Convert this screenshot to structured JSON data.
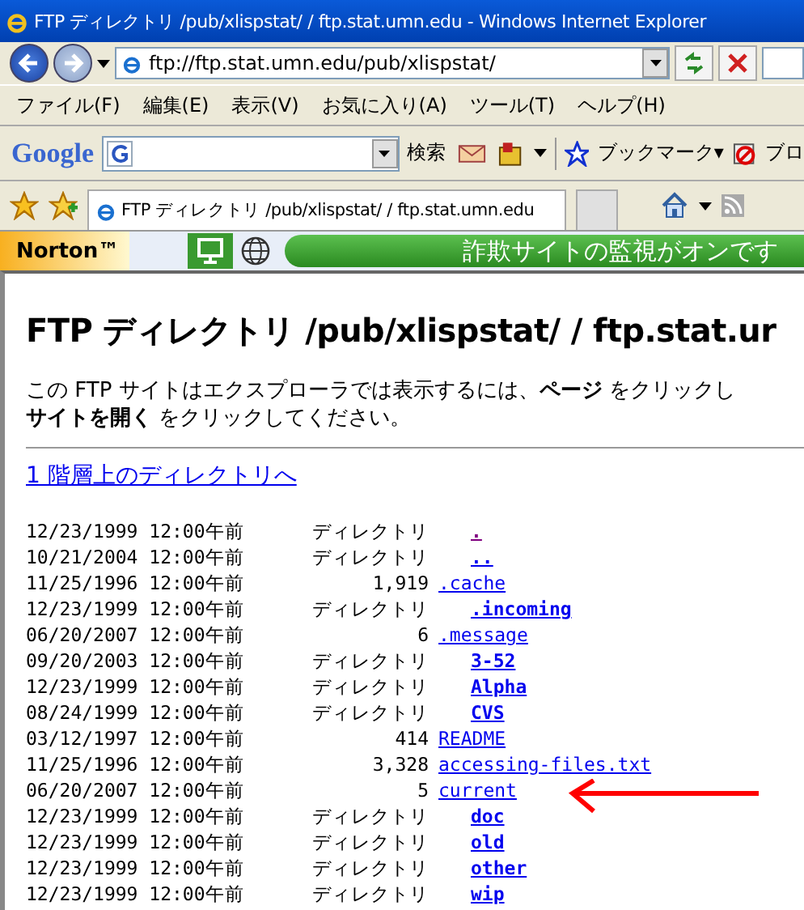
{
  "window": {
    "title": "FTP ディレクトリ /pub/xlispstat/ / ftp.stat.umn.edu - Windows Internet Explorer"
  },
  "address_bar": {
    "value": "ftp://ftp.stat.umn.edu/pub/xlispstat/"
  },
  "menu": [
    "ファイル(F)",
    "編集(E)",
    "表示(V)",
    "お気に入り(A)",
    "ツール(T)",
    "ヘルプ(H)"
  ],
  "google_toolbar": {
    "logo": "Google",
    "search_button": "検索",
    "bookmarks": "ブックマーク▾",
    "cut_item": "ブロ"
  },
  "tabs": [
    {
      "label": "FTP ディレクトリ /pub/xlispstat/ / ftp.stat.umn.edu",
      "selected": true
    }
  ],
  "norton": {
    "logo": "Norton™",
    "status": "詐欺サイトの監視がオンです"
  },
  "page": {
    "heading": "FTP ディレクトリ /pub/xlispstat/ / ftp.stat.ur",
    "notice": "この FTP サイトはエクスプローラでは表示するには、**ページ** をクリックし",
    "notice_2": "**サイトを開く** をクリックしてください。",
    "up_link": "1 階層上のディレクトリへ",
    "rows": [
      {
        "date": "12/23/1999 12:00午前",
        "size": "ディレクトリ",
        "name": ".",
        "kind": "dir",
        "visited": true
      },
      {
        "date": "10/21/2004 12:00午前",
        "size": "ディレクトリ",
        "name": "..",
        "kind": "dir",
        "visited": false
      },
      {
        "date": "11/25/1996 12:00午前",
        "size": "1,919",
        "name": ".cache",
        "kind": "file",
        "visited": false
      },
      {
        "date": "12/23/1999 12:00午前",
        "size": "ディレクトリ",
        "name": ".incoming",
        "kind": "dir",
        "visited": false
      },
      {
        "date": "06/20/2007 12:00午前",
        "size": "6",
        "name": ".message",
        "kind": "file",
        "visited": false
      },
      {
        "date": "09/20/2003 12:00午前",
        "size": "ディレクトリ",
        "name": "3-52",
        "kind": "dir",
        "visited": false
      },
      {
        "date": "12/23/1999 12:00午前",
        "size": "ディレクトリ",
        "name": "Alpha",
        "kind": "dir",
        "visited": false
      },
      {
        "date": "08/24/1999 12:00午前",
        "size": "ディレクトリ",
        "name": "CVS",
        "kind": "dir",
        "visited": false
      },
      {
        "date": "03/12/1997 12:00午前",
        "size": "414",
        "name": "README",
        "kind": "file",
        "visited": false
      },
      {
        "date": "11/25/1996 12:00午前",
        "size": "3,328",
        "name": "accessing-files.txt",
        "kind": "file",
        "visited": false
      },
      {
        "date": "06/20/2007 12:00午前",
        "size": "5",
        "name": "current",
        "kind": "file",
        "visited": false
      },
      {
        "date": "12/23/1999 12:00午前",
        "size": "ディレクトリ",
        "name": "doc",
        "kind": "dir",
        "visited": false
      },
      {
        "date": "12/23/1999 12:00午前",
        "size": "ディレクトリ",
        "name": "old",
        "kind": "dir",
        "visited": false
      },
      {
        "date": "12/23/1999 12:00午前",
        "size": "ディレクトリ",
        "name": "other",
        "kind": "dir",
        "visited": false
      },
      {
        "date": "12/23/1999 12:00午前",
        "size": "ディレクトリ",
        "name": "wip",
        "kind": "dir",
        "visited": false
      }
    ]
  }
}
